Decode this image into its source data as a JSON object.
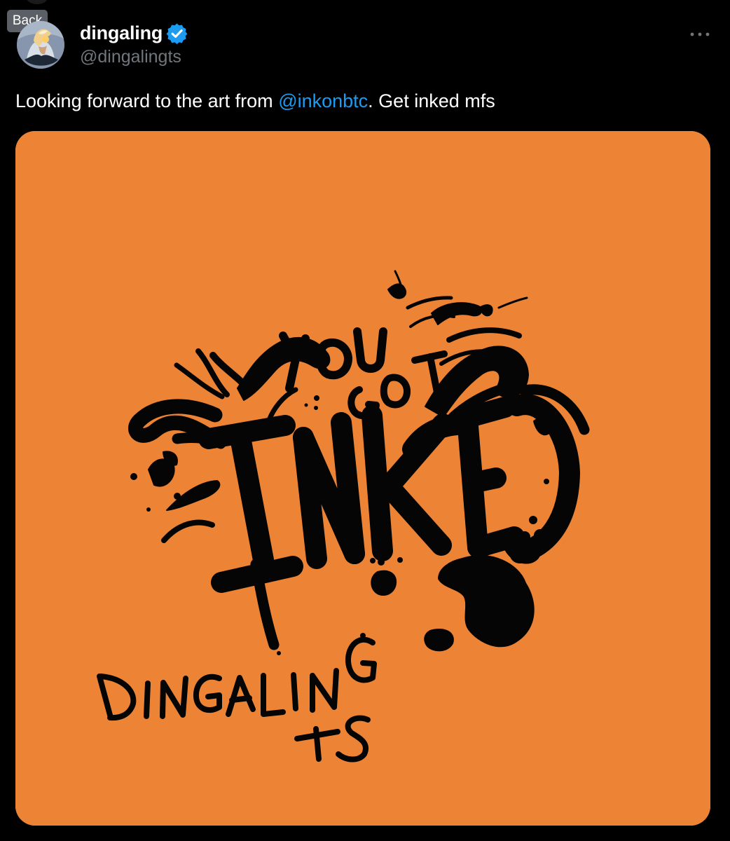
{
  "tooltip": {
    "back_label": "Back"
  },
  "post": {
    "author": {
      "display_name": "dingaling",
      "handle": "@dingalingts",
      "verified": true
    },
    "text_before": "Looking forward to the art from ",
    "mention": "@inkonbtc",
    "text_after": ". Get inked mfs",
    "more_label": "···"
  },
  "media": {
    "artwork_lettering": [
      "YOU",
      "GOT",
      "INKED",
      "DINGALING",
      "TS"
    ],
    "background_color": "#ed8435"
  },
  "colors": {
    "background": "#000000",
    "text_primary": "#ffffff",
    "text_secondary": "#71767b",
    "accent": "#1d9bf0",
    "verified": "#1d9bf0",
    "media": "#ed8435"
  }
}
